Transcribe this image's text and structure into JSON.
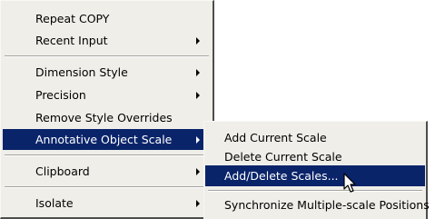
{
  "main_menu": {
    "items": [
      {
        "label": "Repeat COPY",
        "has_submenu": false
      },
      {
        "label": "Recent Input",
        "has_submenu": true
      },
      {
        "label": "Dimension Style",
        "has_submenu": true
      },
      {
        "label": "Precision",
        "has_submenu": true
      },
      {
        "label": "Remove Style Overrides",
        "has_submenu": false
      },
      {
        "label": "Annotative Object Scale",
        "has_submenu": true,
        "selected": true
      },
      {
        "label": "Clipboard",
        "has_submenu": true
      },
      {
        "label": "Isolate",
        "has_submenu": true
      }
    ]
  },
  "sub_menu": {
    "items": [
      {
        "label": "Add Current Scale"
      },
      {
        "label": "Delete Current Scale"
      },
      {
        "label": "Add/Delete Scales...",
        "selected": true
      },
      {
        "label": "Synchronize Multiple-scale Positions"
      }
    ]
  },
  "colors": {
    "menu_background": "#efeee9",
    "highlight": "#0a246a",
    "highlight_text": "#ffffff"
  },
  "cursor_icon": "mouse-pointer-icon"
}
